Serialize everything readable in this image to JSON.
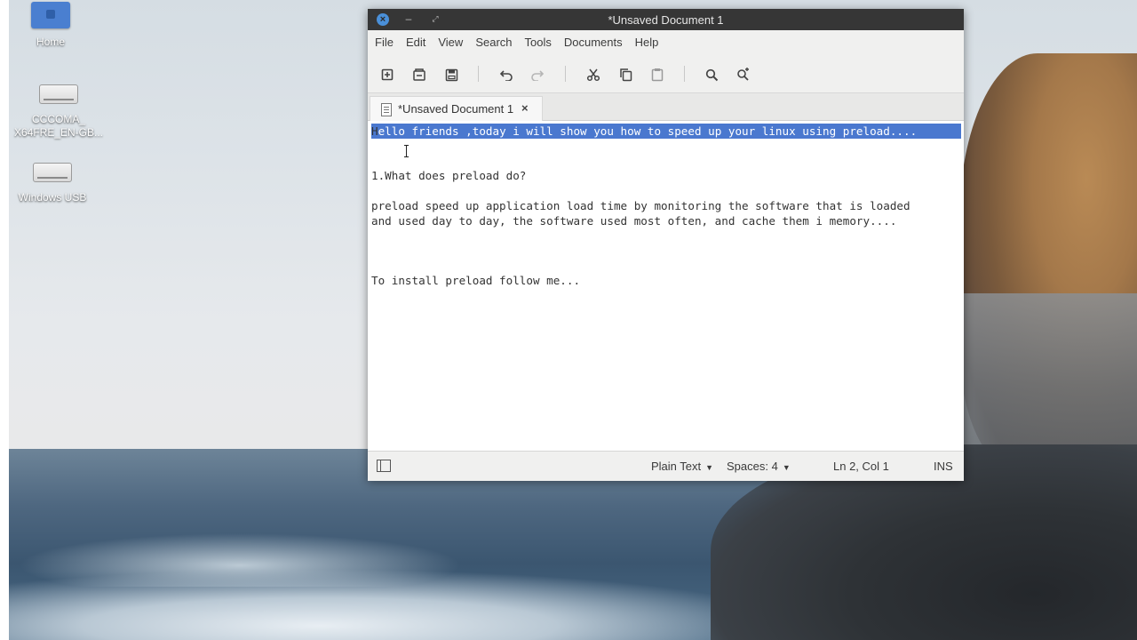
{
  "desktop": {
    "icons": [
      {
        "label": "Home",
        "icon": "folder-icon"
      },
      {
        "label": "CCCOMA_\nX64FRE_EN-GB...",
        "line1": "CCCOMA_",
        "line2": "X64FRE_EN-GB...",
        "icon": "drive-icon"
      },
      {
        "label": "Windows USB",
        "icon": "drive-icon"
      }
    ]
  },
  "window": {
    "title": "*Unsaved Document 1",
    "controls": {
      "close": "×",
      "minimize": "–",
      "maximize": "⤢"
    }
  },
  "menubar": {
    "items": [
      "File",
      "Edit",
      "View",
      "Search",
      "Tools",
      "Documents",
      "Help"
    ]
  },
  "toolbar": {
    "buttons": [
      {
        "name": "new-document",
        "icon": "new-document-icon"
      },
      {
        "name": "open-document",
        "icon": "open-document-icon"
      },
      {
        "name": "save-document",
        "icon": "save-icon"
      },
      {
        "name": "undo",
        "icon": "undo-icon"
      },
      {
        "name": "redo",
        "icon": "redo-icon",
        "disabled": true
      },
      {
        "name": "cut",
        "icon": "cut-icon"
      },
      {
        "name": "copy",
        "icon": "copy-icon"
      },
      {
        "name": "paste",
        "icon": "paste-icon"
      },
      {
        "name": "find",
        "icon": "search-icon"
      },
      {
        "name": "find-replace",
        "icon": "find-replace-icon"
      }
    ]
  },
  "tabs": [
    {
      "label": "*Unsaved Document 1",
      "close": "×"
    }
  ],
  "editor": {
    "lines": {
      "l1_first": "H",
      "l1_rest": "ello friends ,today i will show you how to speed up your linux using preload....",
      "l3": "1.What does preload do?",
      "l5": "preload speed up application load time by monitoring the software that is loaded",
      "l6": "and used day to day, the software used most often, and cache them i memory....",
      "l10": "To install preload follow me..."
    },
    "selection_color": "#4a78cf"
  },
  "statusbar": {
    "language": "Plain Text",
    "spaces": "Spaces: 4",
    "position": "Ln 2, Col 1",
    "mode": "INS"
  },
  "colors": {
    "titlebar": "#363636",
    "accent": "#4a90d9",
    "chrome": "#f0f0ef"
  }
}
